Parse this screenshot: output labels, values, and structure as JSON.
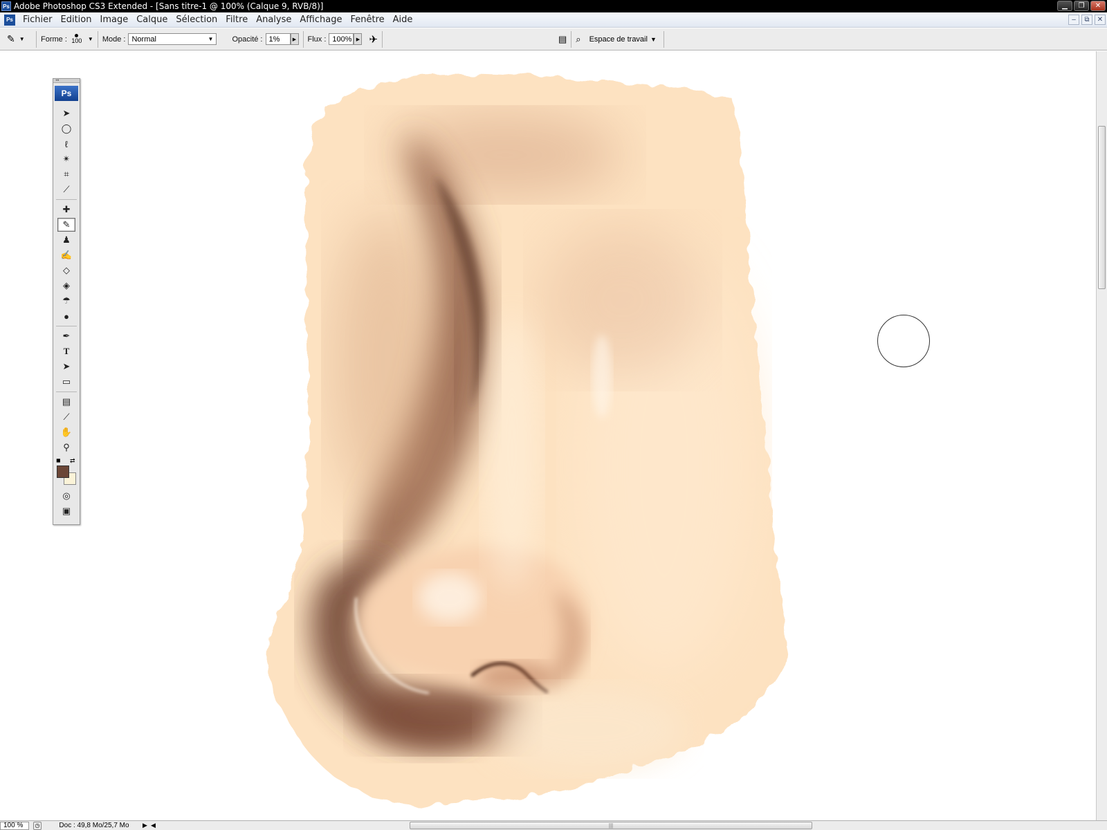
{
  "window": {
    "title": "Adobe Photoshop CS3 Extended - [Sans titre-1 @ 100% (Calque 9, RVB/8)]",
    "logo_text": "Ps",
    "buttons": {
      "minimize": "▁",
      "restore": "❐",
      "close": "✕"
    }
  },
  "menubar": {
    "items": [
      "Fichier",
      "Edition",
      "Image",
      "Calque",
      "Sélection",
      "Filtre",
      "Analyse",
      "Affichage",
      "Fenêtre",
      "Aide"
    ],
    "doc_buttons": {
      "minimize": "–",
      "restore": "⧉",
      "close": "✕"
    }
  },
  "options": {
    "forme_label": "Forme :",
    "brush_size": "100",
    "mode_label": "Mode :",
    "mode_value": "Normal",
    "opacity_label": "Opacité :",
    "opacity_value": "1%",
    "flux_label": "Flux :",
    "flux_value": "100%",
    "workspace_label": "Espace de travail"
  },
  "toolpanel": {
    "logo": "Ps",
    "tools": [
      {
        "name": "move-tool-icon",
        "glyph": "➤"
      },
      {
        "name": "marquee-ellipse-tool-icon",
        "glyph": "◯"
      },
      {
        "name": "lasso-tool-icon",
        "glyph": "ℓ"
      },
      {
        "name": "magic-wand-tool-icon",
        "glyph": "✴"
      },
      {
        "name": "crop-tool-icon",
        "glyph": "⌗"
      },
      {
        "name": "slice-tool-icon",
        "glyph": "⟋"
      },
      {
        "name": "healing-brush-tool-icon",
        "glyph": "✚"
      },
      {
        "name": "brush-tool-icon",
        "glyph": "✎",
        "active": true
      },
      {
        "name": "clone-stamp-tool-icon",
        "glyph": "♟"
      },
      {
        "name": "history-brush-tool-icon",
        "glyph": "✍"
      },
      {
        "name": "eraser-tool-icon",
        "glyph": "◇"
      },
      {
        "name": "paint-bucket-tool-icon",
        "glyph": "◈"
      },
      {
        "name": "blur-tool-icon",
        "glyph": "💧"
      },
      {
        "name": "dodge-tool-icon",
        "glyph": "●"
      },
      {
        "name": "pen-tool-icon",
        "glyph": "✒"
      },
      {
        "name": "type-tool-icon",
        "glyph": "T"
      },
      {
        "name": "path-selection-tool-icon",
        "glyph": "➤"
      },
      {
        "name": "rectangle-shape-tool-icon",
        "glyph": "▭"
      },
      {
        "name": "notes-tool-icon",
        "glyph": "▤"
      },
      {
        "name": "eyedropper-tool-icon",
        "glyph": "⟋"
      },
      {
        "name": "hand-tool-icon",
        "glyph": "✋"
      },
      {
        "name": "zoom-tool-icon",
        "glyph": "🔍"
      }
    ],
    "foreground_color": "#6b4637",
    "background_color": "#fbf3d8"
  },
  "statusbar": {
    "zoom": "100 %",
    "doc_info": "Doc : 49,8 Mo/25,7 Mo"
  },
  "colors": {
    "skin_base": "#fde2c1",
    "shadow_dark": "#7a4c36",
    "shadow_mid": "#b8825f"
  }
}
